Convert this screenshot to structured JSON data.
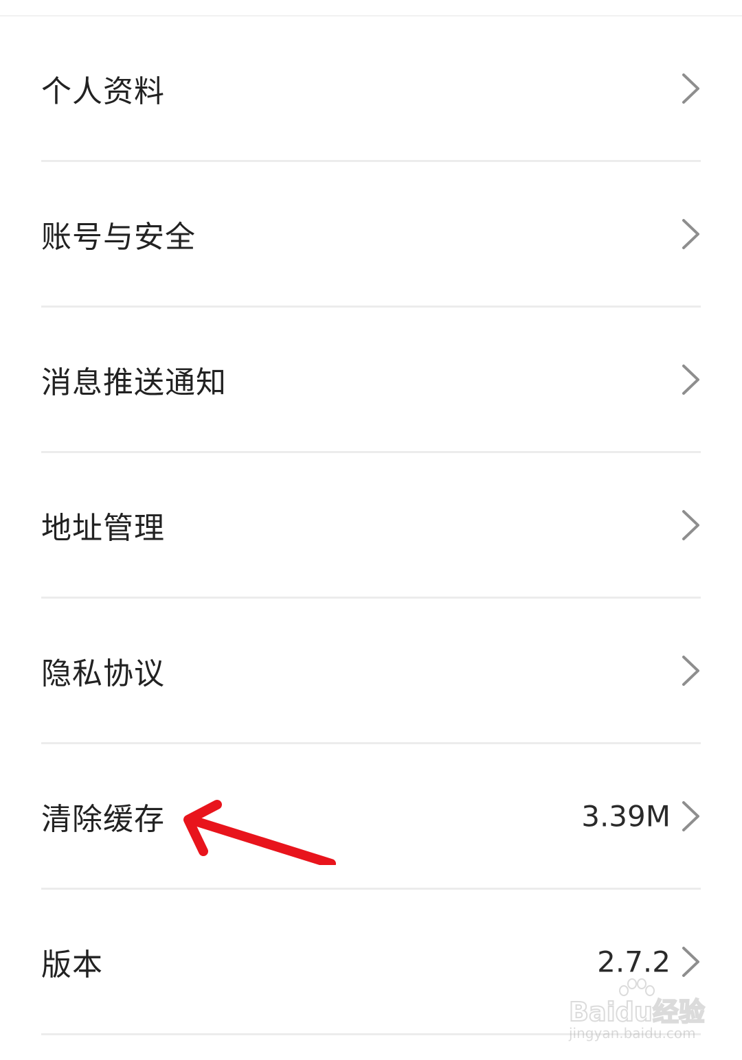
{
  "settings": {
    "items": [
      {
        "label": "个人资料",
        "value": ""
      },
      {
        "label": "账号与安全",
        "value": ""
      },
      {
        "label": "消息推送通知",
        "value": ""
      },
      {
        "label": "地址管理",
        "value": ""
      },
      {
        "label": "隐私协议",
        "value": ""
      },
      {
        "label": "清除缓存",
        "value": "3.39M"
      },
      {
        "label": "版本",
        "value": "2.7.2"
      }
    ]
  },
  "watermark": {
    "main": "Baidu经验",
    "sub": "jingyan.baidu.com"
  },
  "colors": {
    "text": "#222222",
    "divider": "#ececec",
    "chevron": "#8e8e8e",
    "annotation_arrow": "#e8141c"
  },
  "icons": {
    "row_trailing": "chevron-right-icon",
    "annotation": "red-arrow-icon"
  }
}
